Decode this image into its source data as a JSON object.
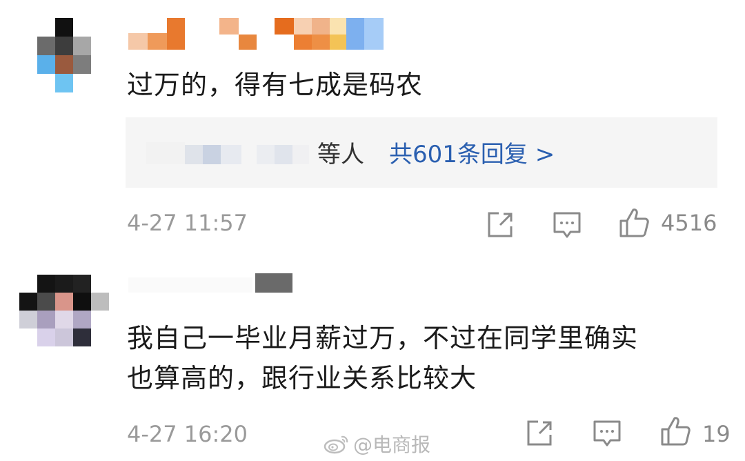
{
  "comments": [
    {
      "text": "过万的，得有七成是码农",
      "reply_summary": {
        "suffix": "等人",
        "link": "共601条回复 >"
      },
      "timestamp": "4-27 11:57",
      "like_count": "4516"
    },
    {
      "text_line1": "我自己一毕业月薪过万，不过在同学里确实",
      "text_line2": "也算高的，跟行业关系比较大",
      "timestamp": "4-27 16:20",
      "like_count": "19"
    }
  ],
  "watermark": "@电商报",
  "icons": {
    "share": "share-icon",
    "comment": "comment-icon",
    "like": "thumbs-up-icon",
    "weibo": "weibo-logo-icon"
  },
  "colors": {
    "link": "#2a5fb0",
    "meta": "#9a9a9a",
    "reply_bg": "#f5f5f5"
  }
}
